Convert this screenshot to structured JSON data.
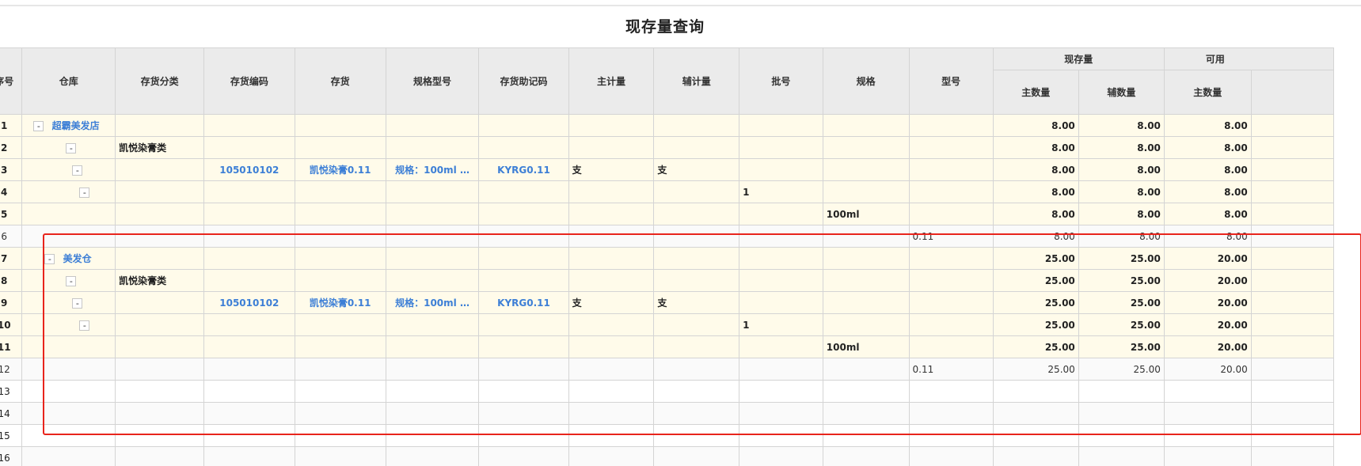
{
  "page": {
    "title": "现存量查询"
  },
  "headers": {
    "seq": "序号",
    "warehouse": "仓库",
    "category": "存货分类",
    "item_code": "存货编码",
    "item": "存货",
    "spec_model": "规格型号",
    "mnemonic": "存货助记码",
    "main_unit": "主计量",
    "aux_unit": "辅计量",
    "batch": "批号",
    "spec": "规格",
    "model": "型号",
    "group_stock": "现存量",
    "group_available": "可用",
    "main_qty": "主数量",
    "aux_qty": "辅数量",
    "avail_main_qty": "主数量"
  },
  "tree_toggle": "-",
  "rows": [
    {
      "seq": "1",
      "warehouse": "超霸美发店",
      "category": "",
      "item_code": "",
      "item": "",
      "spec_model": "",
      "mnemonic": "",
      "main_unit": "",
      "aux_unit": "",
      "batch": "",
      "spec": "",
      "model": "",
      "main_qty": "8.00",
      "aux_qty": "8.00",
      "avail": "8.00"
    },
    {
      "seq": "2",
      "warehouse": "",
      "category": "凯悦染膏类",
      "item_code": "",
      "item": "",
      "spec_model": "",
      "mnemonic": "",
      "main_unit": "",
      "aux_unit": "",
      "batch": "",
      "spec": "",
      "model": "",
      "main_qty": "8.00",
      "aux_qty": "8.00",
      "avail": "8.00"
    },
    {
      "seq": "3",
      "warehouse": "",
      "category": "",
      "item_code": "105010102",
      "item": "凯悦染膏0.11",
      "spec_model": "规格：100ml …",
      "mnemonic": "KYRG0.11",
      "main_unit": "支",
      "aux_unit": "支",
      "batch": "",
      "spec": "",
      "model": "",
      "main_qty": "8.00",
      "aux_qty": "8.00",
      "avail": "8.00"
    },
    {
      "seq": "4",
      "warehouse": "",
      "category": "",
      "item_code": "",
      "item": "",
      "spec_model": "",
      "mnemonic": "",
      "main_unit": "",
      "aux_unit": "",
      "batch": "1",
      "spec": "",
      "model": "",
      "main_qty": "8.00",
      "aux_qty": "8.00",
      "avail": "8.00"
    },
    {
      "seq": "5",
      "warehouse": "",
      "category": "",
      "item_code": "",
      "item": "",
      "spec_model": "",
      "mnemonic": "",
      "main_unit": "",
      "aux_unit": "",
      "batch": "",
      "spec": "100ml",
      "model": "",
      "main_qty": "8.00",
      "aux_qty": "8.00",
      "avail": "8.00"
    },
    {
      "seq": "6",
      "warehouse": "",
      "category": "",
      "item_code": "",
      "item": "",
      "spec_model": "",
      "mnemonic": "",
      "main_unit": "",
      "aux_unit": "",
      "batch": "",
      "spec": "",
      "model": "0.11",
      "main_qty": "8.00",
      "aux_qty": "8.00",
      "avail": "8.00"
    },
    {
      "seq": "7",
      "warehouse": "美发仓",
      "category": "",
      "item_code": "",
      "item": "",
      "spec_model": "",
      "mnemonic": "",
      "main_unit": "",
      "aux_unit": "",
      "batch": "",
      "spec": "",
      "model": "",
      "main_qty": "25.00",
      "aux_qty": "25.00",
      "avail": "20.00"
    },
    {
      "seq": "8",
      "warehouse": "",
      "category": "凯悦染膏类",
      "item_code": "",
      "item": "",
      "spec_model": "",
      "mnemonic": "",
      "main_unit": "",
      "aux_unit": "",
      "batch": "",
      "spec": "",
      "model": "",
      "main_qty": "25.00",
      "aux_qty": "25.00",
      "avail": "20.00"
    },
    {
      "seq": "9",
      "warehouse": "",
      "category": "",
      "item_code": "105010102",
      "item": "凯悦染膏0.11",
      "spec_model": "规格：100ml …",
      "mnemonic": "KYRG0.11",
      "main_unit": "支",
      "aux_unit": "支",
      "batch": "",
      "spec": "",
      "model": "",
      "main_qty": "25.00",
      "aux_qty": "25.00",
      "avail": "20.00"
    },
    {
      "seq": "10",
      "warehouse": "",
      "category": "",
      "item_code": "",
      "item": "",
      "spec_model": "",
      "mnemonic": "",
      "main_unit": "",
      "aux_unit": "",
      "batch": "1",
      "spec": "",
      "model": "",
      "main_qty": "25.00",
      "aux_qty": "25.00",
      "avail": "20.00"
    },
    {
      "seq": "11",
      "warehouse": "",
      "category": "",
      "item_code": "",
      "item": "",
      "spec_model": "",
      "mnemonic": "",
      "main_unit": "",
      "aux_unit": "",
      "batch": "",
      "spec": "100ml",
      "model": "",
      "main_qty": "25.00",
      "aux_qty": "25.00",
      "avail": "20.00"
    },
    {
      "seq": "12",
      "warehouse": "",
      "category": "",
      "item_code": "",
      "item": "",
      "spec_model": "",
      "mnemonic": "",
      "main_unit": "",
      "aux_unit": "",
      "batch": "",
      "spec": "",
      "model": "0.11",
      "main_qty": "25.00",
      "aux_qty": "25.00",
      "avail": "20.00"
    },
    {
      "seq": "13"
    },
    {
      "seq": "14"
    },
    {
      "seq": "15"
    },
    {
      "seq": "16"
    }
  ],
  "highlight": {
    "color": "#e8241c"
  }
}
